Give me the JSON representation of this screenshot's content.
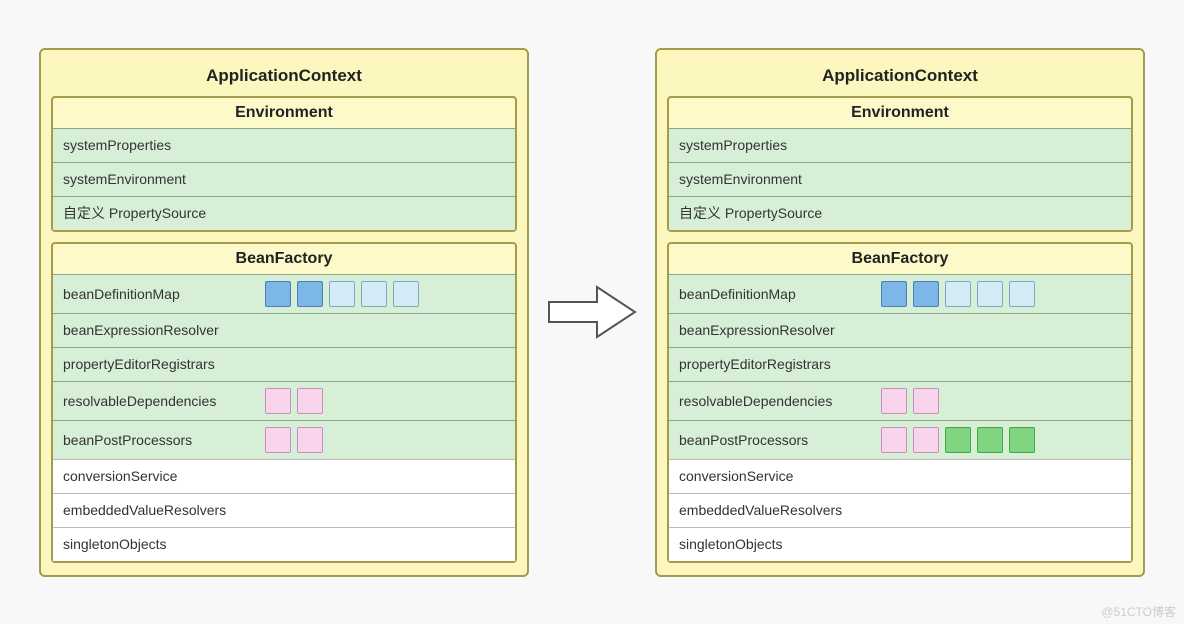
{
  "watermark": "@51CTO博客",
  "boxColors": {
    "blue": "#7cb7e8",
    "lightblue": "#d4ecf7",
    "pink": "#f8d5ed",
    "green": "#80d680"
  },
  "left": {
    "title": "ApplicationContext",
    "environment": {
      "title": "Environment",
      "rows": [
        "systemProperties",
        "systemEnvironment",
        "自定义 PropertySource"
      ]
    },
    "beanFactory": {
      "title": "BeanFactory",
      "rows": [
        {
          "label": "beanDefinitionMap",
          "bg": "green",
          "boxes": [
            "blue",
            "blue",
            "lightblue",
            "lightblue",
            "lightblue"
          ]
        },
        {
          "label": "beanExpressionResolver",
          "bg": "green",
          "boxes": []
        },
        {
          "label": "propertyEditorRegistrars",
          "bg": "green",
          "boxes": []
        },
        {
          "label": "resolvableDependencies",
          "bg": "green",
          "boxes": [
            "pink",
            "pink"
          ]
        },
        {
          "label": "beanPostProcessors",
          "bg": "green",
          "boxes": [
            "pink",
            "pink"
          ]
        },
        {
          "label": "conversionService",
          "bg": "white",
          "boxes": []
        },
        {
          "label": "embeddedValueResolvers",
          "bg": "white",
          "boxes": []
        },
        {
          "label": "singletonObjects",
          "bg": "white",
          "boxes": []
        }
      ]
    }
  },
  "right": {
    "title": "ApplicationContext",
    "environment": {
      "title": "Environment",
      "rows": [
        "systemProperties",
        "systemEnvironment",
        "自定义 PropertySource"
      ]
    },
    "beanFactory": {
      "title": "BeanFactory",
      "rows": [
        {
          "label": "beanDefinitionMap",
          "bg": "green",
          "boxes": [
            "blue",
            "blue",
            "lightblue",
            "lightblue",
            "lightblue"
          ]
        },
        {
          "label": "beanExpressionResolver",
          "bg": "green",
          "boxes": []
        },
        {
          "label": "propertyEditorRegistrars",
          "bg": "green",
          "boxes": []
        },
        {
          "label": "resolvableDependencies",
          "bg": "green",
          "boxes": [
            "pink",
            "pink"
          ]
        },
        {
          "label": "beanPostProcessors",
          "bg": "green",
          "boxes": [
            "pink",
            "pink",
            "green",
            "green",
            "green"
          ]
        },
        {
          "label": "conversionService",
          "bg": "white",
          "boxes": []
        },
        {
          "label": "embeddedValueResolvers",
          "bg": "white",
          "boxes": []
        },
        {
          "label": "singletonObjects",
          "bg": "white",
          "boxes": []
        }
      ]
    }
  }
}
